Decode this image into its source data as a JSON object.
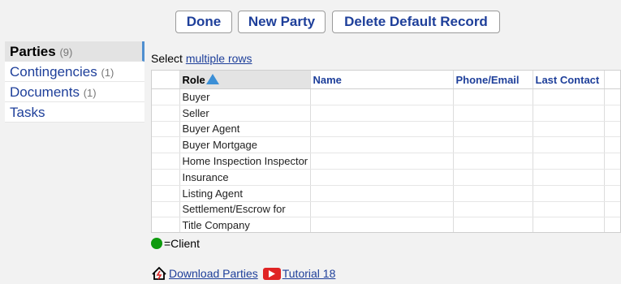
{
  "toolbar": {
    "done_label": "Done",
    "new_party_label": "New Party",
    "delete_default_label": "Delete Default Record"
  },
  "sidebar": {
    "items": [
      {
        "label": "Parties",
        "count": "(9)",
        "active": true
      },
      {
        "label": "Contingencies",
        "count": "(1)"
      },
      {
        "label": "Documents",
        "count": "(1)"
      },
      {
        "label": "Tasks",
        "count": ""
      }
    ]
  },
  "select": {
    "prefix": "Select ",
    "link": "multiple rows"
  },
  "table": {
    "headers": [
      "Role",
      "Name",
      "Phone/Email",
      "Last Contact"
    ],
    "sort_column": "Role",
    "sort_direction": "ascending",
    "rows": [
      "Buyer",
      "Seller",
      "Buyer Agent",
      "Buyer Mortgage",
      "Home Inspection Inspector",
      "Insurance",
      "Listing Agent",
      "Settlement/Escrow for",
      "Title Company"
    ]
  },
  "legend": {
    "text": "=Client",
    "color": "#0d9a0d"
  },
  "links": {
    "download": "Download Parties",
    "tutorial": "Tutorial 18"
  },
  "colors": {
    "link_blue": "#1e3f9a",
    "sort_arrow": "#3b8fd6",
    "youtube_red": "#e02424",
    "active_tab_bar": "#4f8fd0"
  }
}
